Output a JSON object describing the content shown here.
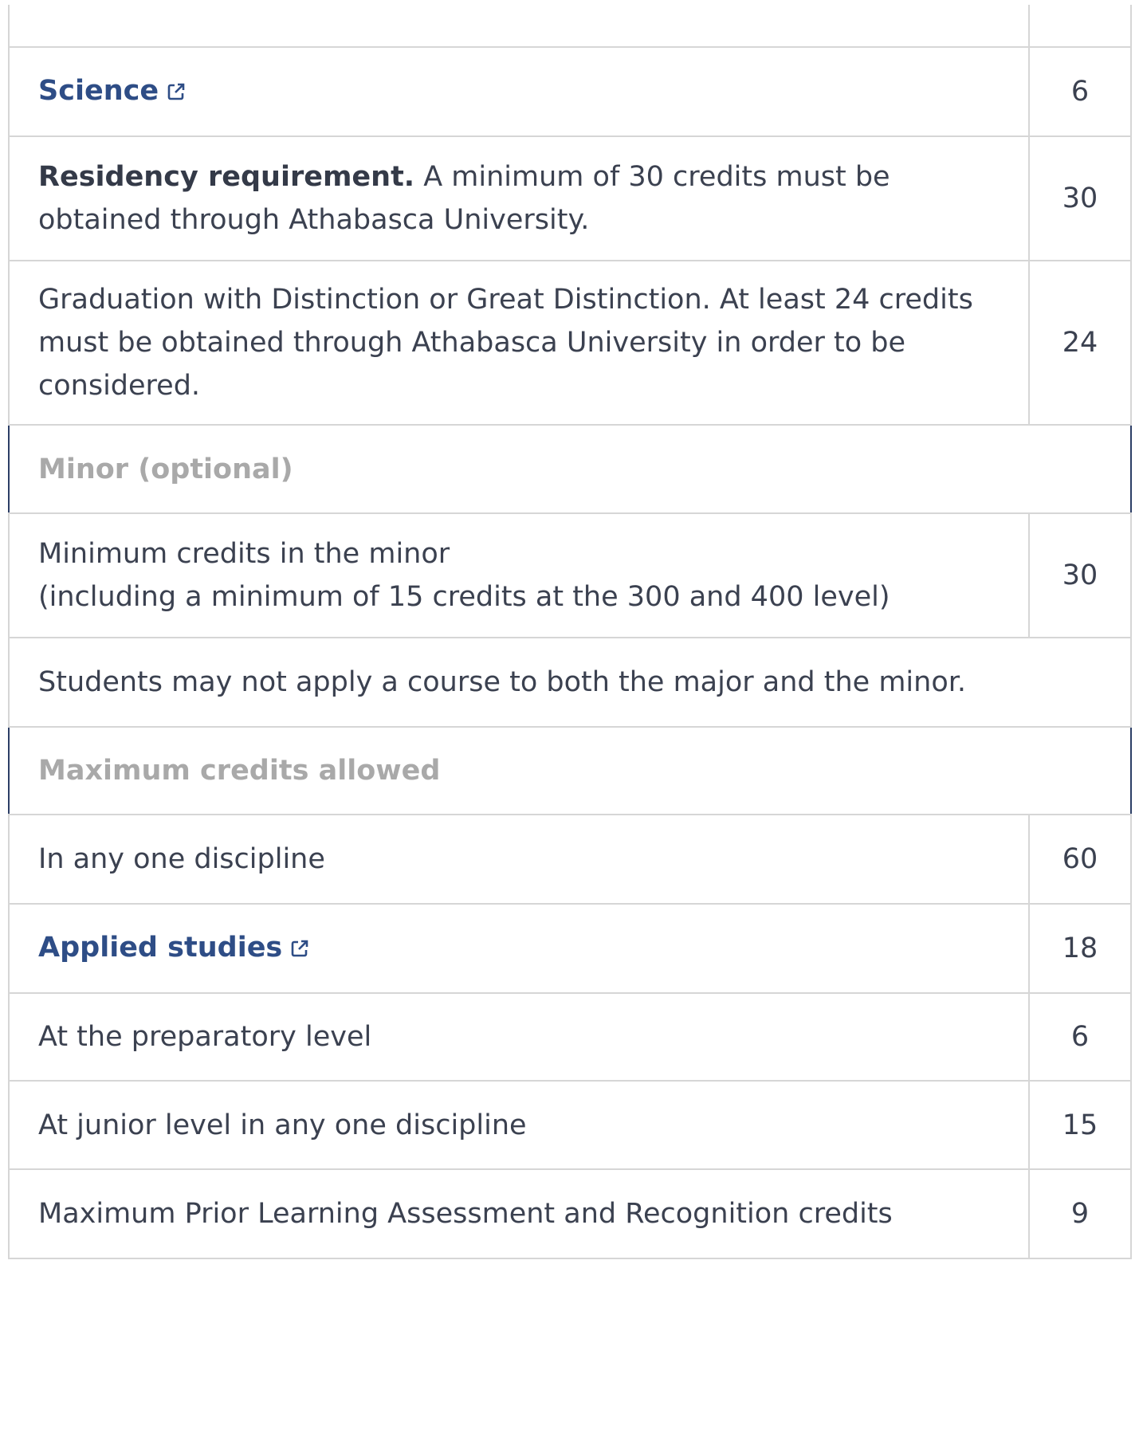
{
  "rows": [
    {
      "kind": "blank",
      "label": "",
      "credits": ""
    },
    {
      "kind": "link",
      "label": "Science",
      "credits": "6"
    },
    {
      "kind": "bold-lead",
      "lead": "Residency requirement.",
      "label": "A minimum of 30 credits must be obtained through Athabasca University.",
      "credits": "30"
    },
    {
      "kind": "plain",
      "label": "Graduation with Distinction or Great Distinction. At least 24 credits must be obtained through Athabasca University in order to be considered.",
      "credits": "24"
    },
    {
      "kind": "section",
      "label": "Minor (optional)"
    },
    {
      "kind": "two-line",
      "line1": "Minimum credits in the minor",
      "line2": "(including a minimum of 15 credits at the 300 and 400 level)",
      "credits": "30"
    },
    {
      "kind": "note",
      "label": "Students may not apply a course to both the major and the minor."
    },
    {
      "kind": "section",
      "label": "Maximum credits allowed"
    },
    {
      "kind": "plain",
      "label": "In any one discipline",
      "credits": "60"
    },
    {
      "kind": "link",
      "label": "Applied studies",
      "credits": "18"
    },
    {
      "kind": "plain",
      "label": "At the preparatory level",
      "credits": "6"
    },
    {
      "kind": "plain",
      "label": "At junior level in any one discipline",
      "credits": "15"
    },
    {
      "kind": "plain",
      "label": "Maximum Prior Learning Assessment and Recognition credits",
      "credits": "9"
    }
  ],
  "icons": {
    "external_link": "external-link-icon"
  },
  "colors": {
    "link": "#2e4d86",
    "section_label": "#a9a9a9",
    "section_border": "#2c3e66",
    "grid": "#d6d6d6"
  }
}
